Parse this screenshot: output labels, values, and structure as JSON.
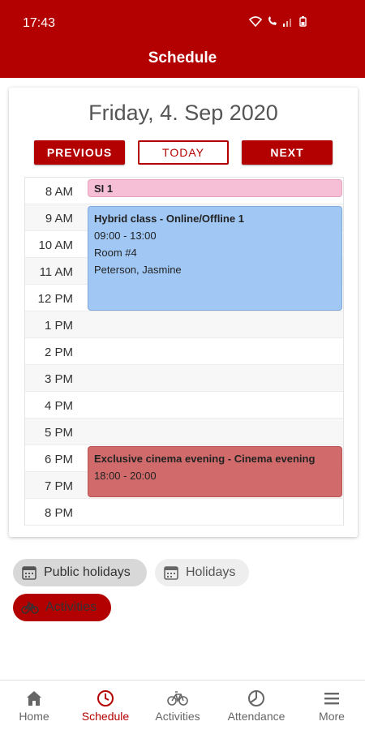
{
  "status_bar": {
    "time": "17:43"
  },
  "app_bar": {
    "title": "Schedule"
  },
  "schedule": {
    "date": "Friday, 4. Sep 2020",
    "buttons": {
      "previous": "PREVIOUS",
      "today": "TODAY",
      "next": "NEXT"
    },
    "hours": [
      "8 AM",
      "9 AM",
      "10 AM",
      "11 AM",
      "12 PM",
      "1 PM",
      "2 PM",
      "3 PM",
      "4 PM",
      "5 PM",
      "6 PM",
      "7 PM",
      "8 PM"
    ],
    "events": [
      {
        "title": "SI 1",
        "color": "#f7bfd6"
      },
      {
        "title": "Hybrid class - Online/Offline 1",
        "time": "09:00 - 13:00",
        "room": "Room #4",
        "teacher": "Peterson, Jasmine",
        "color": "#a1c8f5"
      },
      {
        "title": "Exclusive cinema evening - Cinema evening",
        "time": "18:00 - 20:00",
        "color": "#d16b6b"
      }
    ]
  },
  "filters": [
    {
      "label": "Public holidays",
      "icon": "calendar-icon",
      "selected": true
    },
    {
      "label": "Holidays",
      "icon": "calendar-icon",
      "selected": false
    },
    {
      "label": "Activities",
      "icon": "bicycle-icon",
      "selected": true
    }
  ],
  "bottom_nav": [
    {
      "label": "Home",
      "icon": "home-icon"
    },
    {
      "label": "Schedule",
      "icon": "clock-icon",
      "active": true
    },
    {
      "label": "Activities",
      "icon": "bicycle-icon"
    },
    {
      "label": "Attendance",
      "icon": "pie-chart-icon"
    },
    {
      "label": "More",
      "icon": "menu-icon"
    }
  ],
  "colors": {
    "primary": "#b30000",
    "accent_text": "#ffffff"
  }
}
